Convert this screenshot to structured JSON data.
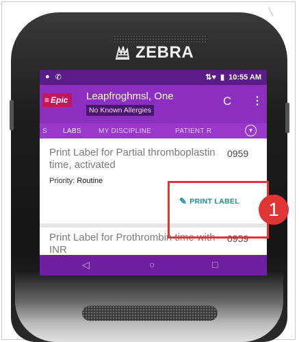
{
  "device": {
    "brand": "ZEBRA"
  },
  "status_bar": {
    "time": "10:55 AM"
  },
  "header": {
    "logo": "Epic",
    "patient_name": "Leapfroghmsl, One",
    "allergies": "No Known Allergies"
  },
  "tabs": [
    {
      "label": "S"
    },
    {
      "label": "LABS"
    },
    {
      "label": "MY DISCIPLINE"
    },
    {
      "label": "PATIENT R"
    }
  ],
  "cards": [
    {
      "title": "Print Label for Partial thromboplastin time, activated",
      "number": "0959",
      "priority_label": "Priority:",
      "priority_value": "Routine",
      "action_label": "PRINT LABEL"
    },
    {
      "title": "Print Label for Prothrombin time with INR",
      "number": "0959"
    }
  ],
  "callout": {
    "number": "1"
  },
  "colors": {
    "status_bar": "#5a1c86",
    "header": "#8a2fbf",
    "epic_logo": "#c2185b",
    "print_label": "#1a8f8f",
    "highlight": "#e03535"
  }
}
